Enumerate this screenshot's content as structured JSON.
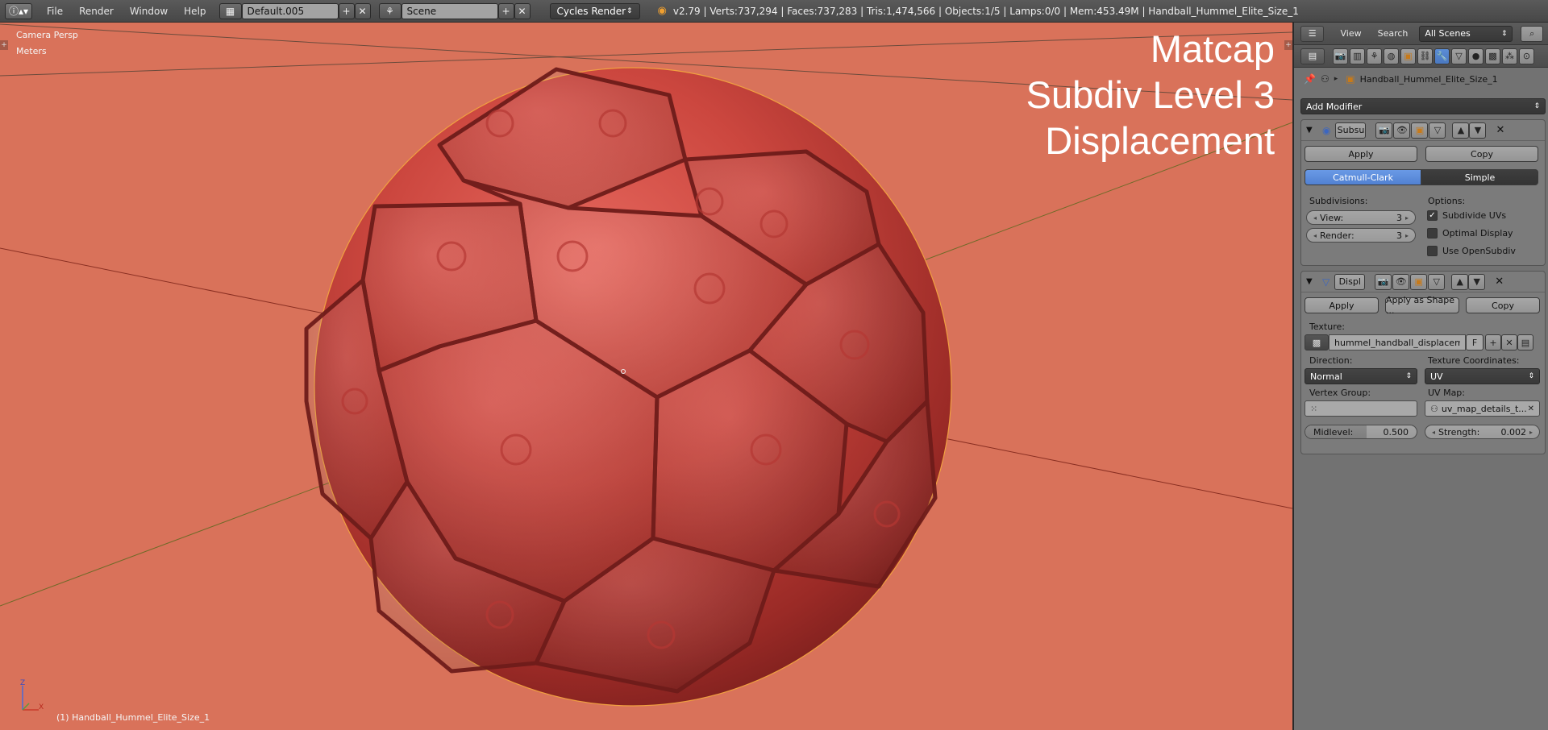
{
  "header": {
    "menus": [
      "File",
      "Render",
      "Window",
      "Help"
    ],
    "screen_layout": "Default.005",
    "scene": "Scene",
    "render_engine": "Cycles Render",
    "stats": "v2.79 | Verts:737,294 | Faces:737,283 | Tris:1,474,566 | Objects:1/5 | Lamps:0/0 | Mem:453.49M | Handball_Hummel_Elite_Size_1"
  },
  "viewport": {
    "view_name": "Camera Persp",
    "units": "Meters",
    "overlay_lines": [
      "Matcap",
      "Subdiv Level 3",
      "Displacement"
    ],
    "object_label": "(1) Handball_Hummel_Elite_Size_1",
    "axis_x": "X",
    "axis_z": "Z",
    "background_color": "#d9725a",
    "ball_color": "#c8463e"
  },
  "properties": {
    "view_menu": "View",
    "search_menu": "Search",
    "scene_filter": "All Scenes",
    "object_name": "Handball_Hummel_Elite_Size_1",
    "add_modifier": "Add Modifier",
    "subsurf": {
      "name": "Subsu",
      "apply": "Apply",
      "copy": "Copy",
      "algo_catmull": "Catmull-Clark",
      "algo_simple": "Simple",
      "subdivisions_label": "Subdivisions:",
      "view_label": "View:",
      "view_value": "3",
      "render_label": "Render:",
      "render_value": "3",
      "options_label": "Options:",
      "opt_subdivide_uvs": "Subdivide UVs",
      "opt_optimal_display": "Optimal Display",
      "opt_use_opensubdiv": "Use OpenSubdiv"
    },
    "displace": {
      "name": "Displ",
      "apply": "Apply",
      "apply_shape": "Apply as Shape ...",
      "copy": "Copy",
      "texture_label": "Texture:",
      "texture_name": "hummel_handball_displacem...",
      "texture_f": "F",
      "direction_label": "Direction:",
      "direction_value": "Normal",
      "texcoords_label": "Texture Coordinates:",
      "texcoords_value": "UV",
      "vertex_group_label": "Vertex Group:",
      "uv_map_label": "UV Map:",
      "uv_map_value": "uv_map_details_t...",
      "midlevel_label": "Midlevel:",
      "midlevel_value": "0.500",
      "strength_label": "Strength:",
      "strength_value": "0.002"
    }
  }
}
